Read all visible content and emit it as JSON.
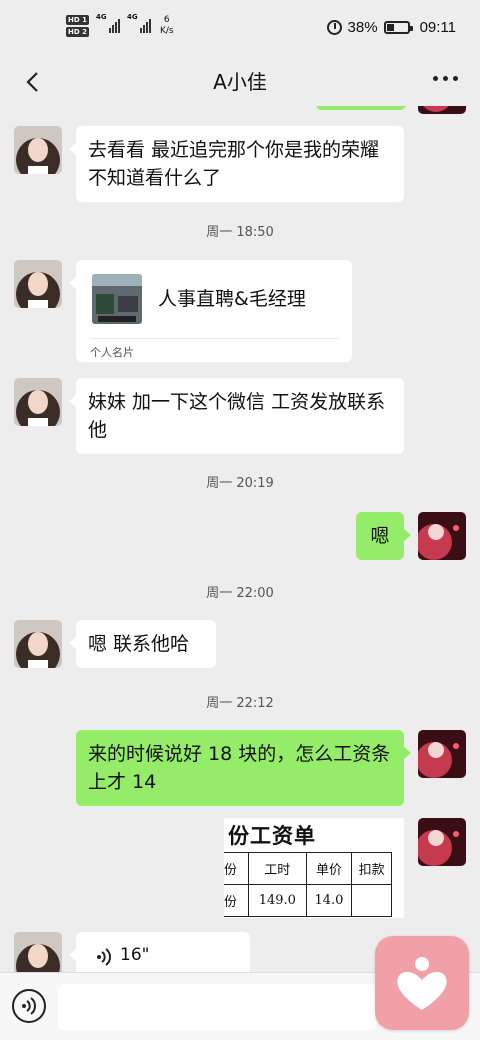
{
  "status_bar": {
    "hd1": "HD 1",
    "hd2": "HD 2",
    "signal1": "4G",
    "signal2": "4G",
    "speed_value": "6",
    "speed_unit": "K/s",
    "battery": "38%",
    "time": "09:11",
    "battery_level": 0.38
  },
  "nav": {
    "title": "A小佳",
    "back_icon": "chevron-left-icon",
    "more_icon": "more-dots-icon"
  },
  "messages": {
    "m1": "去看看  最近追完那个你是我的荣耀 不知道看什么了",
    "ts1": "周一 18:50",
    "card_name": "人事直聘&毛经理",
    "card_type": "个人名片",
    "m2": "妹妹 加一下这个微信  工资发放联系他",
    "ts2": "周一 20:19",
    "m3": "嗯",
    "ts3": "周一 22:00",
    "m4": "嗯  联系他哈",
    "ts4": "周一 22:12",
    "m5": "来的时候说好 18 块的，怎么工资条上才 14",
    "voice_duration": "16\""
  },
  "payslip": {
    "title": "月份工资单",
    "headers": [
      "份",
      "工时",
      "单价",
      "扣款"
    ],
    "row": [
      "份",
      "149.0",
      "14.0",
      ""
    ]
  },
  "input_bar": {
    "placeholder": "",
    "voice_icon": "voice-toggle-icon"
  },
  "colors": {
    "background": "#ededed",
    "incoming_bubble": "#ffffff",
    "outgoing_bubble": "#95ec69",
    "float_app": "#f2a0a8"
  }
}
